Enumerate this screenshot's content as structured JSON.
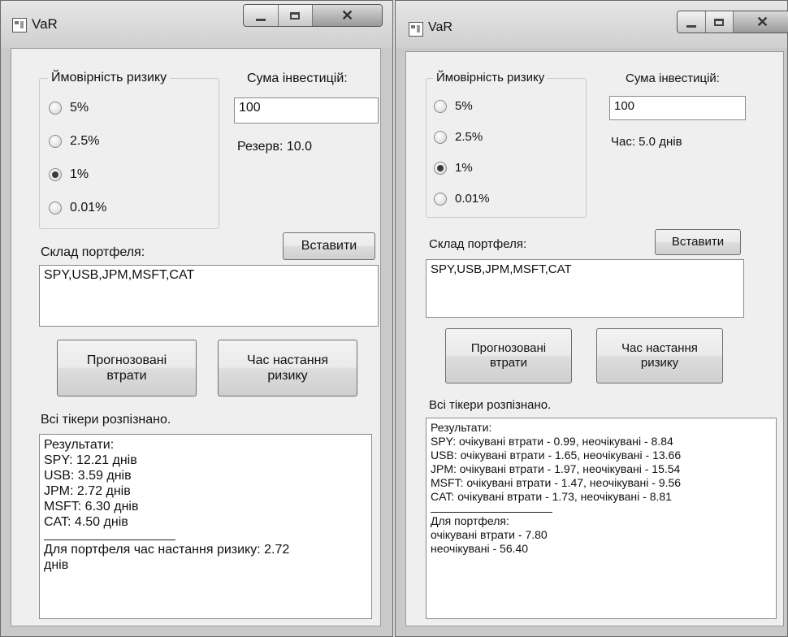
{
  "windows": [
    {
      "title": "VaR",
      "risk_group_label": "Ймовірність ризику",
      "risk_options": [
        {
          "label": "5%",
          "selected": false
        },
        {
          "label": "2.5%",
          "selected": false
        },
        {
          "label": "1%",
          "selected": true
        },
        {
          "label": "0.01%",
          "selected": false
        }
      ],
      "investment_label": "Сума інвестицій:",
      "investment_value": "100",
      "status_info": "Резерв: 10.0",
      "portfolio_label": "Склад портфеля:",
      "paste_button": "Вставити",
      "portfolio_value": "SPY,USB,JPM,MSFT,CAT",
      "forecast_button": [
        "Прогнозовані",
        "втрати"
      ],
      "risk_time_button": [
        "Час настання",
        "ризику"
      ],
      "tickers_status": "Всі тікери розпізнано.",
      "results_lines": [
        "Результати:",
        "SPY: 12.21 днів",
        "USB: 3.59 днів",
        "JPM: 2.72 днів",
        "MSFT: 6.30 днів",
        "CAT: 4.50 днів"
      ],
      "results_summary": [
        "Для портфеля час настання ризику: 2.72",
        "днів"
      ]
    },
    {
      "title": "VaR",
      "risk_group_label": "Ймовірність ризику",
      "risk_options": [
        {
          "label": "5%",
          "selected": false
        },
        {
          "label": "2.5%",
          "selected": false
        },
        {
          "label": "1%",
          "selected": true
        },
        {
          "label": "0.01%",
          "selected": false
        }
      ],
      "investment_label": "Сума інвестицій:",
      "investment_value": "100",
      "status_info": "Час: 5.0 днів",
      "portfolio_label": "Склад портфеля:",
      "paste_button": "Вставити",
      "portfolio_value": "SPY,USB,JPM,MSFT,CAT",
      "forecast_button": [
        "Прогнозовані",
        "втрати"
      ],
      "risk_time_button": [
        "Час настання",
        "ризику"
      ],
      "tickers_status": "Всі тікери розпізнано.",
      "results_lines": [
        "Результати:",
        "SPY: очікувані втрати - 0.99, неочікувані - 8.84",
        "USB: очікувані втрати - 1.65, неочікувані - 13.66",
        "JPM: очікувані втрати - 1.97, неочікувані - 15.54",
        "MSFT: очікувані втрати - 1.47, неочікувані - 9.56",
        "CAT: очікувані втрати - 1.73, неочікувані - 8.81"
      ],
      "results_summary": [
        "Для портфеля:",
        "очікувані втрати - 7.80",
        "неочікувані - 56.40"
      ]
    }
  ]
}
